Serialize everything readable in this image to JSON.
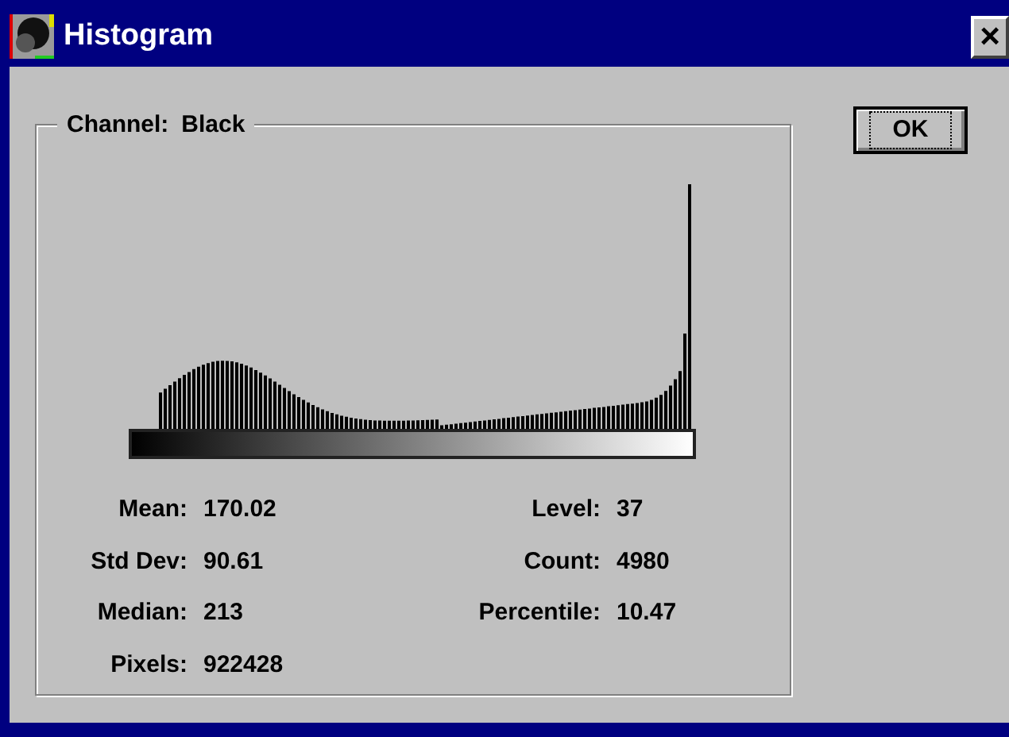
{
  "window": {
    "title": "Histogram",
    "close": "×"
  },
  "channel": {
    "label": "Channel:",
    "value": "Black"
  },
  "buttons": [
    {
      "label": "OK",
      "focused": true
    }
  ],
  "stats_left": [
    {
      "label": "Mean:",
      "value": "170.02"
    },
    {
      "label": "Std Dev:",
      "value": "90.61"
    },
    {
      "label": "Median:",
      "value": "213"
    },
    {
      "label": "Pixels:",
      "value": "922428"
    }
  ],
  "stats_right": [
    {
      "label": "Level:",
      "value": "37"
    },
    {
      "label": "Count:",
      "value": "4980"
    },
    {
      "label": "Percentile:",
      "value": "10.47"
    }
  ]
}
